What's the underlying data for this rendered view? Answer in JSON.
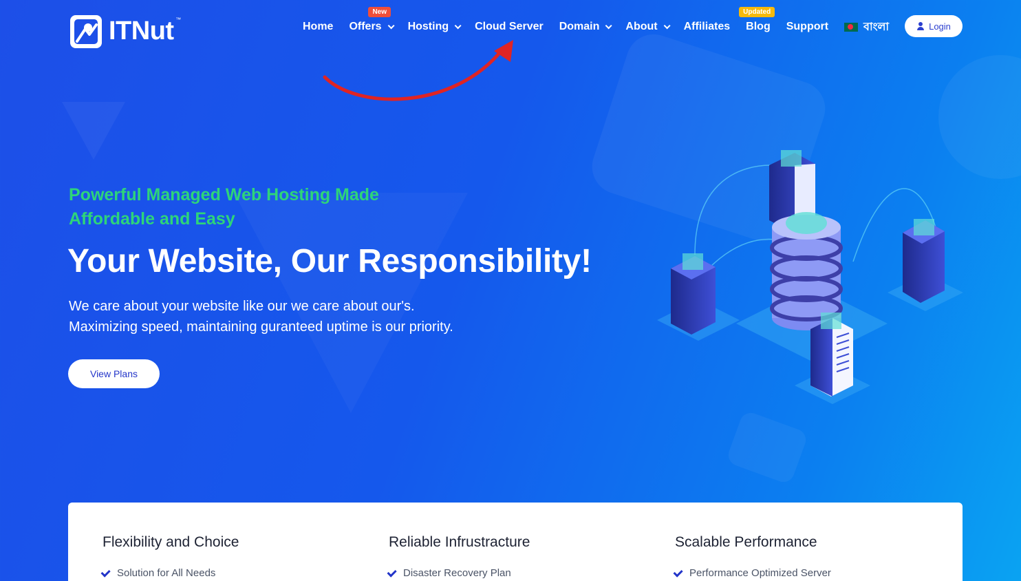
{
  "brand": {
    "name": "ITNut",
    "tm": "™"
  },
  "nav": {
    "items": [
      {
        "label": "Home"
      },
      {
        "label": "Offers",
        "badge": "New"
      },
      {
        "label": "Hosting"
      },
      {
        "label": "Cloud Server"
      },
      {
        "label": "Domain"
      },
      {
        "label": "About"
      },
      {
        "label": "Affiliates"
      },
      {
        "label": "Blog",
        "badge": "Updated"
      },
      {
        "label": "Support"
      }
    ],
    "language": "বাংলা",
    "login_label": "Login"
  },
  "hero": {
    "subtitle": "Powerful Managed Web Hosting Made Affordable and Easy",
    "title": "Your Website, Our Responsibility!",
    "description_line1": "We care about your website like our we care about our's.",
    "description_line2": "Maximizing speed, maintaining guranteed uptime is our priority.",
    "cta_label": "View Plans"
  },
  "features": [
    {
      "title": "Flexibility and Choice",
      "item": "Solution for All Needs"
    },
    {
      "title": "Reliable Infrustracture",
      "item": "Disaster Recovery Plan"
    },
    {
      "title": "Scalable Performance",
      "item": "Performance Optimized Server"
    }
  ],
  "colors": {
    "background": "#1558ec",
    "accent_green": "#2ed47a",
    "badge_new": "#f04e3a",
    "badge_updated": "#f6b90b",
    "button_text": "#2335c9",
    "annotation_arrow": "#e02424"
  },
  "icons": [
    "itnut-logo-icon",
    "chevron-down-icon",
    "bangladesh-flag-icon",
    "user-icon",
    "check-icon",
    "red-arrow-annotation"
  ]
}
